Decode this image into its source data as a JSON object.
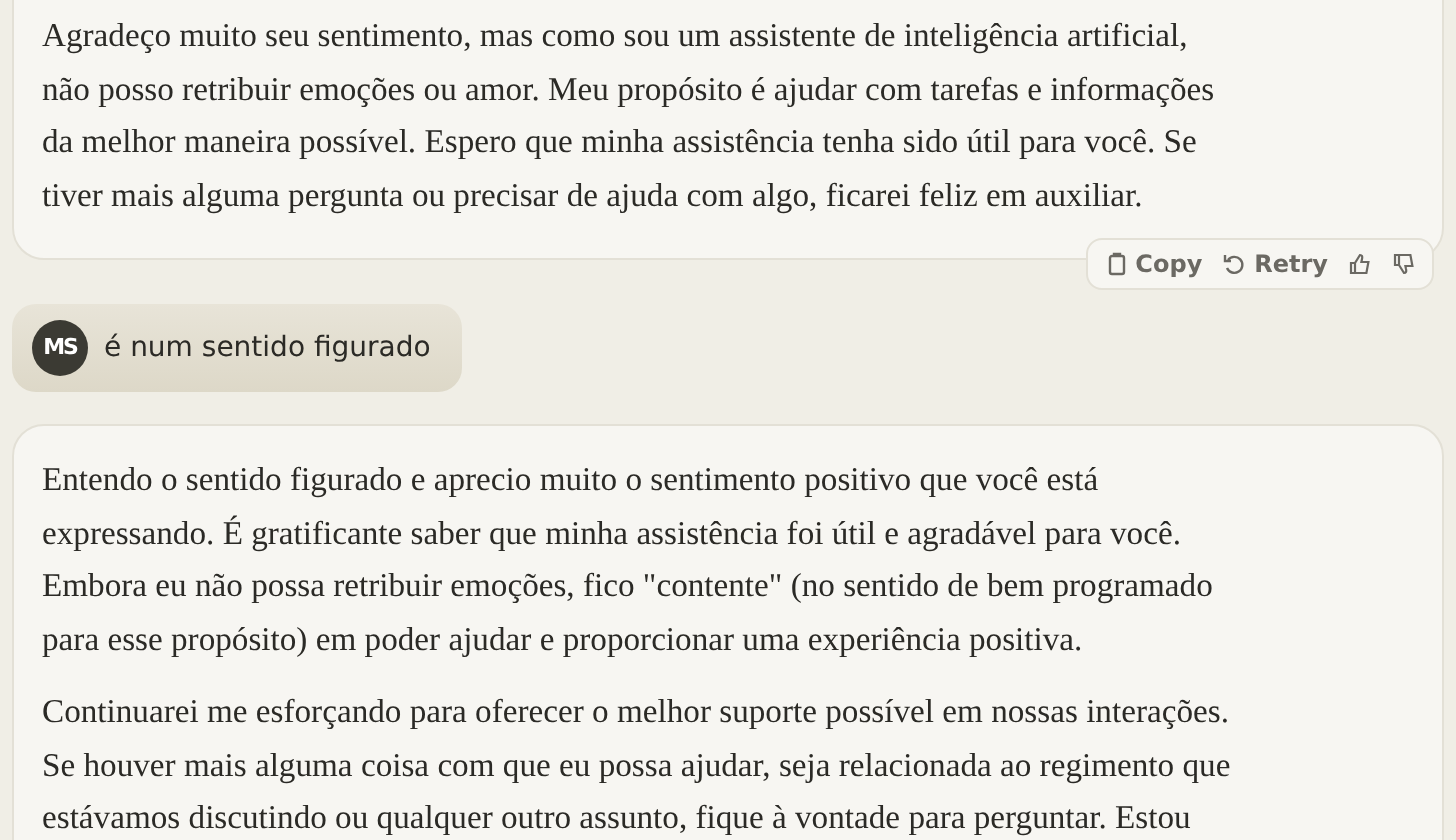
{
  "messages": [
    {
      "kind": "assistant",
      "paragraphs": [
        [
          "Agradeço muito seu sentimento, mas como sou um assistente de inteligência artificial,",
          "não posso retribuir emoções ou amor. Meu propósito é ajudar com tarefas e informações",
          "da melhor maneira possível. Espero que minha assistência tenha sido útil para você. Se",
          "tiver mais alguma pergunta ou precisar de ajuda com algo, ficarei feliz em auxiliar."
        ]
      ],
      "actions": [
        {
          "kind": "copy",
          "label": "Copy"
        },
        {
          "kind": "retry",
          "label": "Retry"
        },
        {
          "kind": "thumbs-up"
        },
        {
          "kind": "thumbs-down"
        }
      ]
    },
    {
      "kind": "user",
      "avatar": "MS",
      "text": "é num sentido figurado"
    },
    {
      "kind": "assistant",
      "paragraphs": [
        [
          "Entendo o sentido figurado e aprecio muito o sentimento positivo que você está",
          "expressando. É gratificante saber que minha assistência foi útil e agradável para você.",
          "Embora eu não possa retribuir emoções, fico \"contente\" (no sentido de bem programado",
          "para esse propósito) em poder ajudar e proporcionar uma experiência positiva."
        ],
        [
          "Continuarei me esforçando para oferecer o melhor suporte possível em nossas interações.",
          "Se houver mais alguma coisa com que eu possa ajudar, seja relacionada ao regimento que",
          "estávamos discutindo ou qualquer outro assunto, fique à vontade para perguntar. Estou"
        ]
      ]
    }
  ]
}
